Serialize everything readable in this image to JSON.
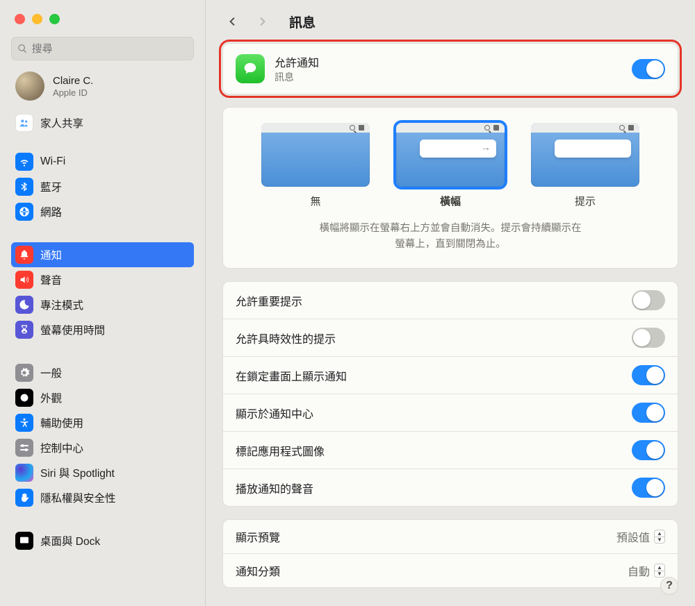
{
  "search": {
    "placeholder": "搜尋"
  },
  "account": {
    "name": "Claire C.",
    "sub": "Apple ID"
  },
  "family_label": "家人共享",
  "sidebar": {
    "group_network": [
      {
        "label": "Wi-Fi"
      },
      {
        "label": "藍牙"
      },
      {
        "label": "網路"
      }
    ],
    "group_focus": [
      {
        "label": "通知"
      },
      {
        "label": "聲音"
      },
      {
        "label": "專注模式"
      },
      {
        "label": "螢幕使用時間"
      }
    ],
    "group_general": [
      {
        "label": "一般"
      },
      {
        "label": "外觀"
      },
      {
        "label": "輔助使用"
      },
      {
        "label": "控制中心"
      },
      {
        "label": "Siri 與 Spotlight"
      },
      {
        "label": "隱私權與安全性"
      }
    ],
    "group_desktop": [
      {
        "label": "桌面與 Dock"
      }
    ]
  },
  "header": {
    "title": "訊息"
  },
  "allow": {
    "title": "允許通知",
    "sub": "訊息",
    "on": true
  },
  "styles": {
    "options": [
      {
        "label": "無"
      },
      {
        "label": "橫幅"
      },
      {
        "label": "提示"
      }
    ],
    "caption_line1": "橫幅將顯示在螢幕右上方並會自動消失。提示會持續顯示在",
    "caption_line2": "螢幕上，直到關閉為止。"
  },
  "toggles": [
    {
      "label": "允許重要提示",
      "on": false
    },
    {
      "label": "允許具時效性的提示",
      "on": false
    },
    {
      "label": "在鎖定畫面上顯示通知",
      "on": true
    },
    {
      "label": "顯示於通知中心",
      "on": true
    },
    {
      "label": "標記應用程式圖像",
      "on": true
    },
    {
      "label": "播放通知的聲音",
      "on": true
    }
  ],
  "selects": [
    {
      "label": "顯示預覽",
      "value": "預設值"
    },
    {
      "label": "通知分類",
      "value": "自動"
    }
  ],
  "help": "?"
}
